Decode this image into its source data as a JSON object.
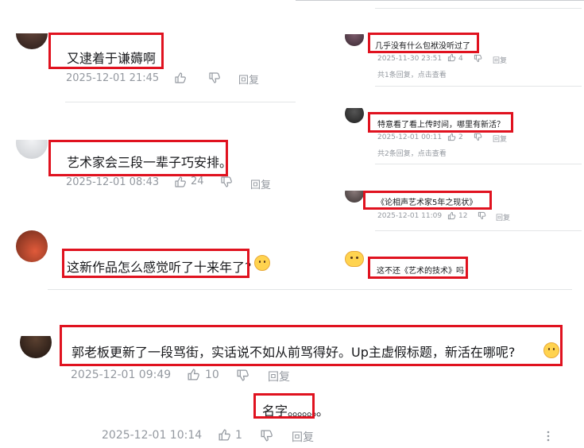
{
  "icons": {
    "like": "thumbs-up-icon",
    "dislike": "thumbs-down-icon",
    "more": "more-vertical-icon"
  },
  "colors": {
    "highlight": "#e0121f",
    "meta_text": "#9499a0",
    "body_text": "#18191c"
  },
  "left_comments": [
    {
      "text": "又逮着于谦薅啊",
      "time": "2025-12-01 21:45",
      "likes": "",
      "reply": "回复"
    },
    {
      "text": "艺术家会三段一辈子巧安排。",
      "time": "2025-12-01 08:43",
      "likes": "24",
      "reply": "回复"
    },
    {
      "text": "这新作品怎么感觉听了十来年了?",
      "emoji": "cat-face-emoji"
    }
  ],
  "right_comments": [
    {
      "text": "几乎没有什么包袱没听过了",
      "time": "2025-11-30 23:51",
      "likes": "4",
      "reply": "回复",
      "sub": "共1条回复，点击查看"
    },
    {
      "text": "特意看了看上传时间，哪里有新活？",
      "time": "2025-12-01 00:11",
      "likes": "2",
      "reply": "回复",
      "sub": "共2条回复，点击查看"
    },
    {
      "text": "《论相声艺术家5年之现状》",
      "time": "2025-12-01 11:09",
      "likes": "12",
      "reply": "回复"
    },
    {
      "text": "这不还《艺术的技术》吗"
    }
  ],
  "bottom_comments": [
    {
      "text": "郭老板更新了一段骂街，实话说不如从前骂得好。Up主虚假标题，新活在哪呢?",
      "time": "2025-12-01 09:49",
      "likes": "10",
      "reply": "回复",
      "emoji": "cat-face-emoji"
    },
    {
      "text": "名字",
      "trail": "。。。。。。。",
      "time": "2025-12-01 10:14",
      "likes": "1",
      "reply": "回复"
    }
  ]
}
